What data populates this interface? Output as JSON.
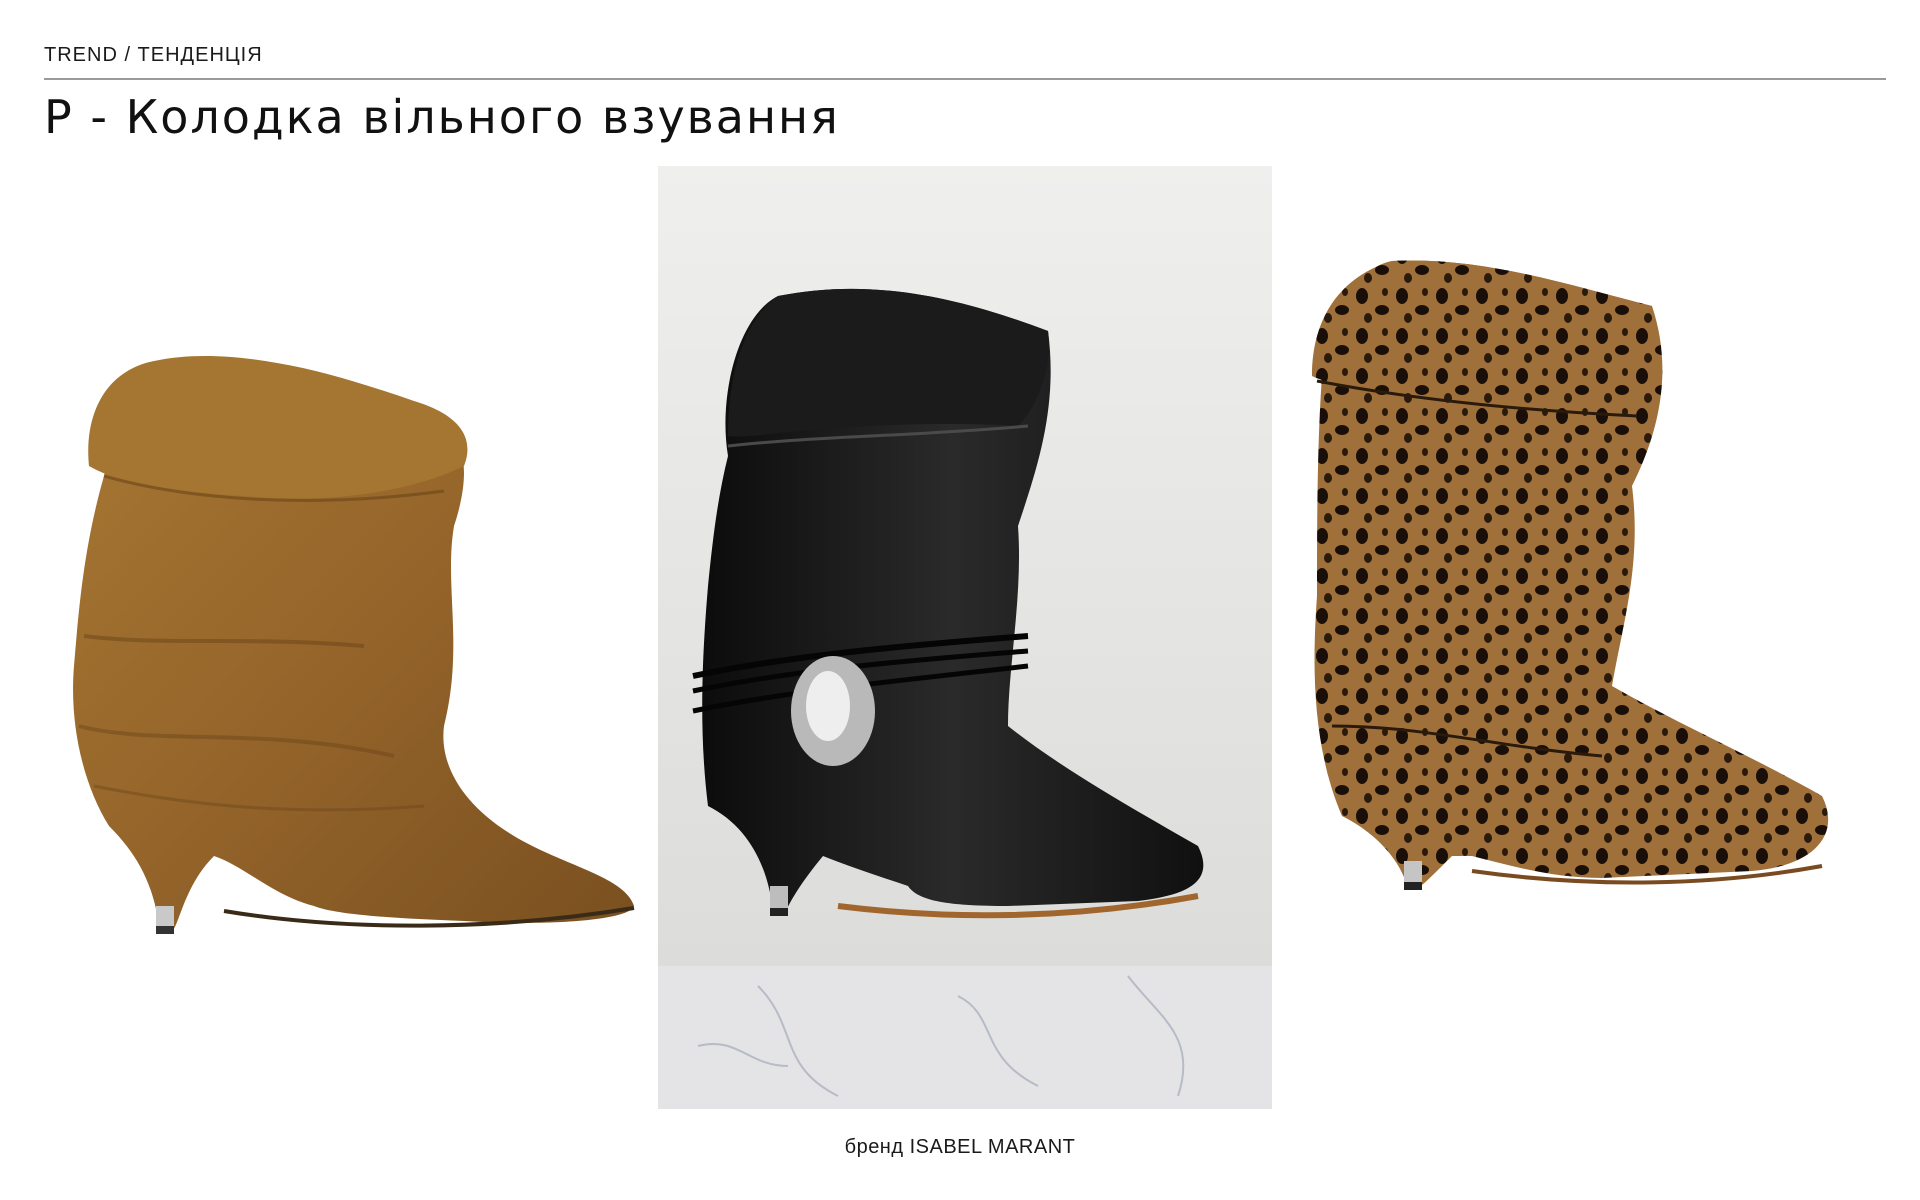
{
  "header": {
    "breadcrumb": "TREND / ТЕНДЕНЦІЯ",
    "title": "P - Колодка вільного взування"
  },
  "gallery": {
    "images": [
      {
        "name": "suede-slouch-boot",
        "color": "#9a6a2c"
      },
      {
        "name": "black-leather-slouch-boot",
        "color": "#1a1a1a"
      },
      {
        "name": "leopard-print-slouch-boot",
        "color": "#8a5a28"
      }
    ]
  },
  "caption": "бренд ISABEL MARANT",
  "colors": {
    "divider": "#9a9a9a",
    "text": "#111111",
    "center_background": "#ececeb"
  }
}
